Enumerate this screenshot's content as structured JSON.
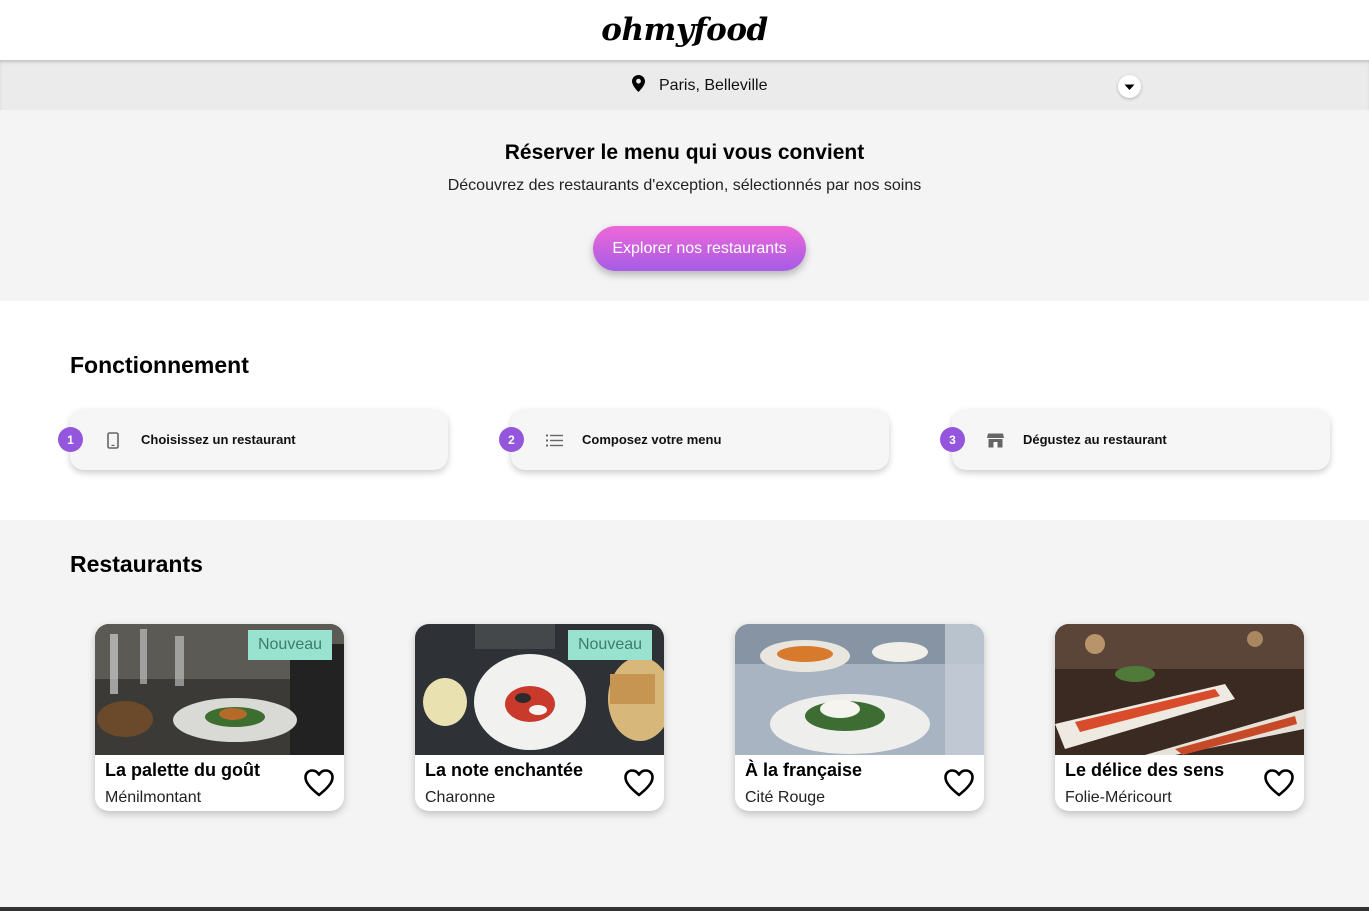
{
  "header": {
    "logo": "ohmyfood"
  },
  "location": {
    "text": "Paris, Belleville",
    "pin_icon": "map-pin-icon",
    "dropdown_icon": "chevron-down-icon"
  },
  "hero": {
    "title": "Réserver le menu qui vous convient",
    "subtitle": "Découvrez des restaurants d'exception, sélectionnés par nos soins",
    "cta_label": "Explorer nos restaurants"
  },
  "how": {
    "title": "Fonctionnement",
    "steps": [
      {
        "number": "1",
        "label": "Choisissez un restaurant",
        "icon": "phone-icon"
      },
      {
        "number": "2",
        "label": "Composez votre menu",
        "icon": "list-icon"
      },
      {
        "number": "3",
        "label": "Dégustez au restaurant",
        "icon": "store-icon"
      }
    ]
  },
  "restaurants": {
    "title": "Restaurants",
    "cards": [
      {
        "name": "La palette du goût",
        "area": "Ménilmontant",
        "badge": "Nouveau"
      },
      {
        "name": "La note enchantée",
        "area": "Charonne",
        "badge": "Nouveau"
      },
      {
        "name": "À la française",
        "area": "Cité Rouge",
        "badge": ""
      },
      {
        "name": "Le délice des sens",
        "area": "Folie-Méricourt",
        "badge": ""
      }
    ]
  },
  "colors": {
    "accent": "#9356dc",
    "cta_top": "#ef68d8",
    "cta_bottom": "#a55ce6",
    "badge_bg": "#99e2d0",
    "badge_text": "#3c7d6c"
  }
}
